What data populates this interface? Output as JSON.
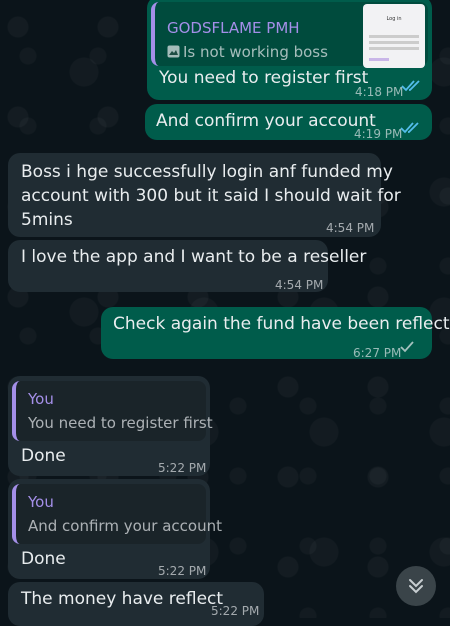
{
  "messages": {
    "m1": {
      "reply_author": "GODSFLAME PMH",
      "reply_text": "Is not working boss",
      "thumb_title": "Log in",
      "text": "You need to register first",
      "time": "4:18 PM"
    },
    "m2": {
      "text": "And confirm your account",
      "time": "4:19 PM"
    },
    "m3": {
      "line1": "Boss i hge successfully login anf funded my",
      "line2": "account with 300 but it said I should wait for",
      "line3": "5mins",
      "time": "4:54 PM"
    },
    "m4": {
      "text": "I love the app and I want to be a reseller",
      "time": "4:54 PM"
    },
    "m5": {
      "text": "Check again the fund have been reflected",
      "time": "6:27 PM"
    },
    "m6": {
      "reply_author": "You",
      "reply_text": "You need to register first",
      "text": "Done",
      "time": "5:22 PM"
    },
    "m7": {
      "reply_author": "You",
      "reply_text": "And confirm your account",
      "text": "Done",
      "time": "5:22 PM"
    },
    "m8": {
      "text": "The money have reflect",
      "time": "5:22 PM"
    }
  },
  "colors": {
    "outgoing": "#005c4b",
    "incoming": "#202c33",
    "read_tick": "#53bdeb",
    "reply_accent": "#a48fe8"
  },
  "icons": {
    "scroll": "double-chevron-down-icon",
    "photo": "photo-icon"
  }
}
